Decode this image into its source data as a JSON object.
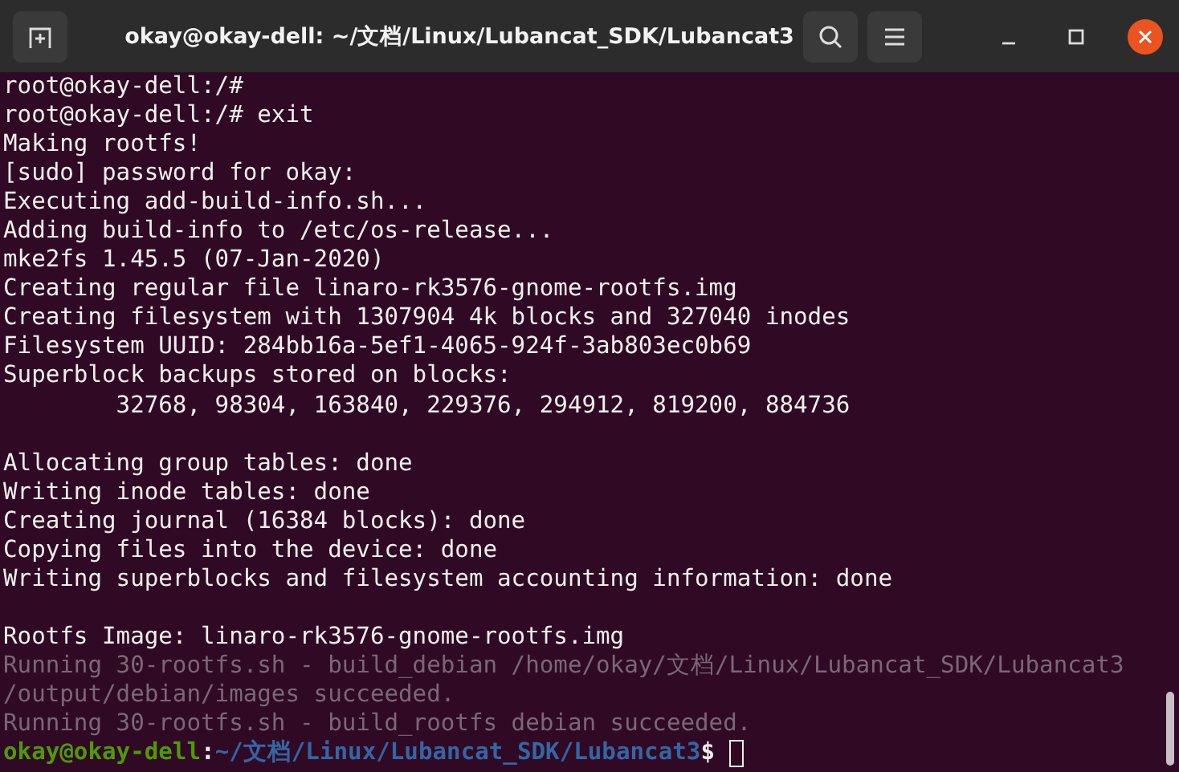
{
  "window": {
    "title": "okay@okay-dell: ~/文档/Linux/Lubancat_SDK/Lubancat3"
  },
  "terminal": {
    "lines": [
      {
        "kind": "normal",
        "text": "root@okay-dell:/#"
      },
      {
        "kind": "normal",
        "text": "root@okay-dell:/# exit"
      },
      {
        "kind": "normal",
        "text": "Making rootfs!"
      },
      {
        "kind": "normal",
        "text": "[sudo] password for okay:"
      },
      {
        "kind": "normal",
        "text": "Executing add-build-info.sh..."
      },
      {
        "kind": "normal",
        "text": "Adding build-info to /etc/os-release..."
      },
      {
        "kind": "normal",
        "text": "mke2fs 1.45.5 (07-Jan-2020)"
      },
      {
        "kind": "normal",
        "text": "Creating regular file linaro-rk3576-gnome-rootfs.img"
      },
      {
        "kind": "normal",
        "text": "Creating filesystem with 1307904 4k blocks and 327040 inodes"
      },
      {
        "kind": "normal",
        "text": "Filesystem UUID: 284bb16a-5ef1-4065-924f-3ab803ec0b69"
      },
      {
        "kind": "normal",
        "text": "Superblock backups stored on blocks:"
      },
      {
        "kind": "normal",
        "text": "        32768, 98304, 163840, 229376, 294912, 819200, 884736"
      },
      {
        "kind": "blank"
      },
      {
        "kind": "normal",
        "text": "Allocating group tables: done"
      },
      {
        "kind": "normal",
        "text": "Writing inode tables: done"
      },
      {
        "kind": "normal",
        "text": "Creating journal (16384 blocks): done"
      },
      {
        "kind": "normal",
        "text": "Copying files into the device: done"
      },
      {
        "kind": "normal",
        "text": "Writing superblocks and filesystem accounting information: done"
      },
      {
        "kind": "blank"
      },
      {
        "kind": "normal",
        "text": "Rootfs Image: linaro-rk3576-gnome-rootfs.img"
      },
      {
        "kind": "dim",
        "text": "Running 30-rootfs.sh - build_debian /home/okay/文档/Linux/Lubancat_SDK/Lubancat3"
      },
      {
        "kind": "dim",
        "text": "/output/debian/images succeeded."
      },
      {
        "kind": "dim",
        "text": "Running 30-rootfs.sh - build_rootfs debian succeeded."
      }
    ],
    "prompt": [
      {
        "kind": "user",
        "text": "okay@okay-dell"
      },
      {
        "kind": "plain",
        "text": ":"
      },
      {
        "kind": "path",
        "text": "~/文档/Linux/Lubancat_SDK/Lubancat3"
      },
      {
        "kind": "plain",
        "text": "$"
      }
    ]
  }
}
